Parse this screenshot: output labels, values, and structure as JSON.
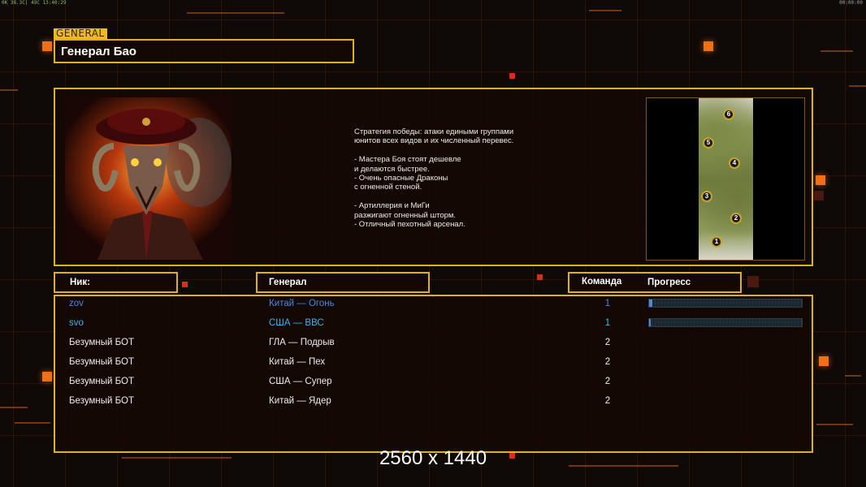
{
  "hud": {
    "top_left": "0K 38.3C| 49C 13:40:29",
    "top_right": "00:00:00"
  },
  "header": {
    "tag": "GENERAL",
    "general_name": "Генерал Бао"
  },
  "description": [
    "Стратегия победы: атаки едиными группами",
    "юнитов всех видов и их численный перевес.",
    "",
    "- Мастера Боя стоят дешевле",
    "и делаются быстрее.",
    "- Очень опасные Драконы",
    "с огненной стеной.",
    "",
    "- Артиллерия и МиГи",
    "разжигают огненный шторм.",
    "- Отличный пехотный арсенал."
  ],
  "map": {
    "markers": [
      "6",
      "5",
      "4",
      "3",
      "2",
      "1"
    ]
  },
  "columns": {
    "nick": "Ник:",
    "general": "Генерал",
    "team": "Команда",
    "progress": "Прогресс"
  },
  "players": [
    {
      "nick": "zov",
      "general": "Китай — Огонь",
      "team": "1",
      "color": "#4f86e0",
      "progress": 0.02
    },
    {
      "nick": "svo",
      "general": "США — ВВС",
      "team": "1",
      "color": "#3fb4ea",
      "progress": 0.01
    },
    {
      "nick": "Безумный БОТ",
      "general": "ГЛА — Подрыв",
      "team": "2",
      "color": "#ededed",
      "progress": null
    },
    {
      "nick": "Безумный БОТ",
      "general": "Китай — Пех",
      "team": "2",
      "color": "#ededed",
      "progress": null
    },
    {
      "nick": "Безумный БОТ",
      "general": "США — Супер",
      "team": "2",
      "color": "#ededed",
      "progress": null
    },
    {
      "nick": "Безумный БОТ",
      "general": "Китай — Ядер",
      "team": "2",
      "color": "#ededed",
      "progress": null
    }
  ],
  "resolution_label": "2560 x 1440"
}
